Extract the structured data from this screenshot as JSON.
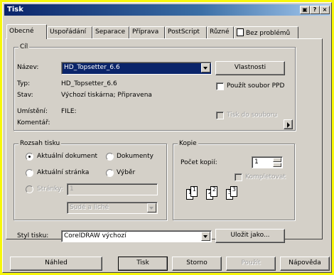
{
  "window": {
    "title": "Tisk"
  },
  "titlebar_buttons": [
    "▣",
    "?",
    "×"
  ],
  "tabs": [
    "Obecné",
    "Uspořádání",
    "Separace",
    "Příprava",
    "PostScript",
    "Různé",
    "Bez problémů"
  ],
  "dest": {
    "group": "Cíl",
    "name_label": "Název:",
    "name_value": "HD_Topsetter_6.6",
    "props_btn": "Vlastnosti",
    "type_label": "Typ:",
    "type_value": "HD_Topsetter_6.6",
    "status_label": "Stav:",
    "status_value": "Výchozí tiskárna; Připravena",
    "loc_label": "Umístění:",
    "loc_value": "FILE:",
    "comment_label": "Komentář:",
    "ppd_label": "Použít soubor PPD",
    "tofile_label": "Tisk do souboru"
  },
  "range": {
    "group": "Rozsah tisku",
    "current_doc": "Aktuální dokument",
    "documents": "Dokumenty",
    "current_page": "Aktuální stránka",
    "selection": "Výběr",
    "pages_label": "Stránky:",
    "pages_value": "1",
    "oddeven": "Sudé a liché"
  },
  "copies": {
    "group": "Kopie",
    "count_label": "Počet kopií:",
    "count_value": "1",
    "collate_label": "Kompletovat",
    "page_nums": [
      "1",
      "1",
      "2",
      "2",
      "3",
      "3"
    ]
  },
  "style": {
    "label": "Styl tisku:",
    "value": "CorelDRAW výchozí",
    "save_btn": "Uložit jako..."
  },
  "bottom": {
    "preview": "Náhled",
    "print": "Tisk",
    "cancel": "Storno",
    "apply": "Použít",
    "help": "Nápověda"
  }
}
